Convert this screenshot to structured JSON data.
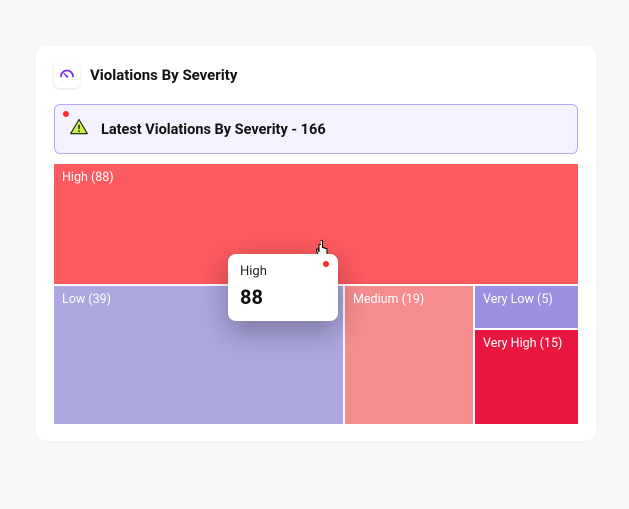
{
  "header": {
    "title": "Violations By Severity"
  },
  "summary": {
    "label": "Latest Violations By Severity - 166"
  },
  "tiles": {
    "high": {
      "label": "High (88)"
    },
    "low": {
      "label": "Low (39)"
    },
    "medium": {
      "label": "Medium (19)"
    },
    "vlow": {
      "label": "Very Low (5)"
    },
    "vhigh": {
      "label": "Very High (15)"
    }
  },
  "tooltip": {
    "label": "High",
    "value": "88"
  },
  "colors": {
    "high": "#fb5a5e",
    "low": "#ada7e0",
    "medium": "#f58c8f",
    "vlow": "#9c8ee0",
    "vhigh": "#e9163f",
    "summary_bg": "#f6f1ff",
    "summary_border": "#b9a6ff"
  },
  "chart_data": {
    "type": "area",
    "title": "Latest Violations By Severity - 166",
    "total": 166,
    "series": [
      {
        "name": "High",
        "value": 88,
        "color": "#fb5a5e"
      },
      {
        "name": "Low",
        "value": 39,
        "color": "#ada7e0"
      },
      {
        "name": "Medium",
        "value": 19,
        "color": "#f58c8f"
      },
      {
        "name": "Very High",
        "value": 15,
        "color": "#e9163f"
      },
      {
        "name": "Very Low",
        "value": 5,
        "color": "#9c8ee0"
      }
    ],
    "hover": {
      "name": "High",
      "value": 88
    }
  }
}
